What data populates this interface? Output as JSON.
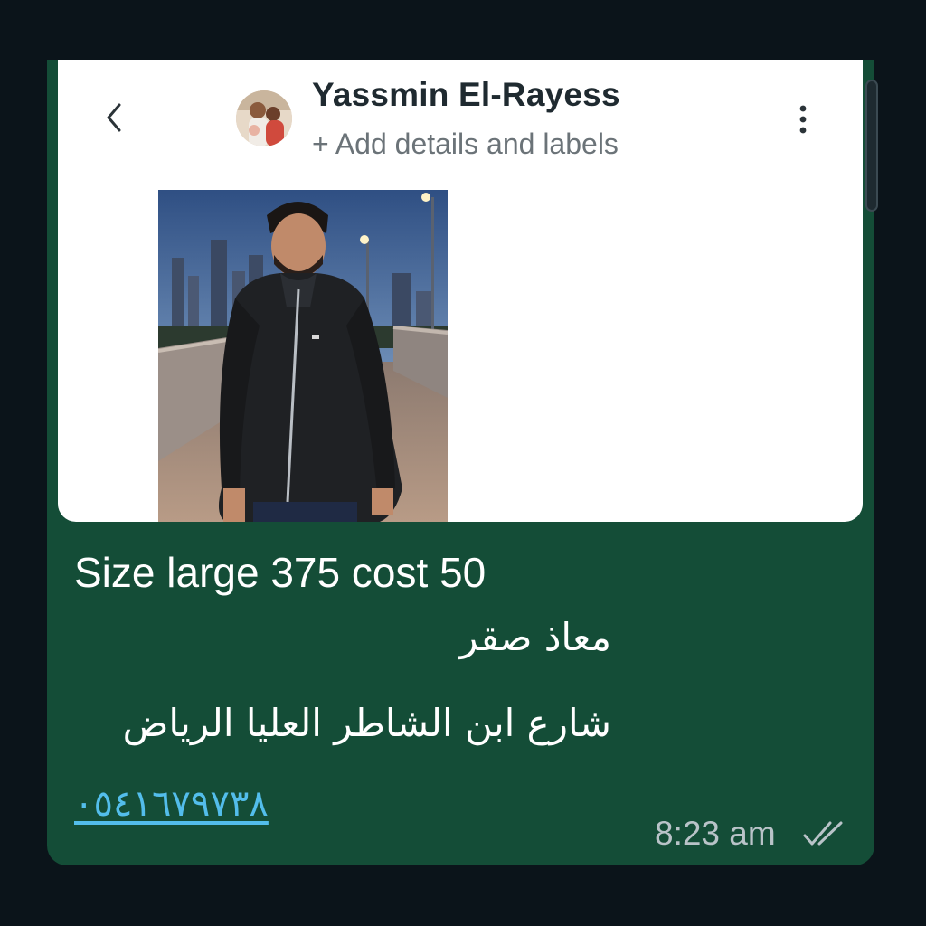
{
  "header": {
    "contact_name": "Yassmin El-Rayess",
    "add_details": "+ Add details and labels",
    "back_icon": "chevron-left-icon",
    "menu_icon": "more-vertical-icon"
  },
  "message": {
    "line1": "Size large 375 cost 50",
    "line2": "معاذ صقر",
    "line3": "شارع ابن الشاطر العليا الرياض",
    "phone": "٠٥٤١٦٧٩٧٣٨",
    "time": "8:23 am",
    "status_icon": "double-check-icon"
  },
  "colors": {
    "bubble": "#144d37",
    "background": "#0b141a",
    "link": "#53bdeb",
    "ticks": "#b9c3c8"
  }
}
